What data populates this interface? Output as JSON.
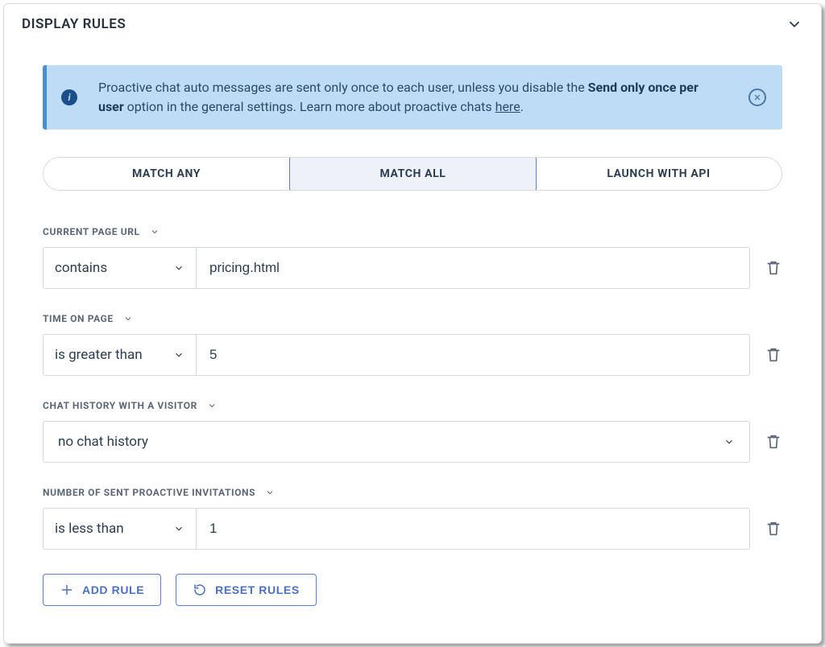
{
  "header": {
    "title": "DISPLAY RULES"
  },
  "banner": {
    "text_a": "Proactive chat auto messages are sent only once to each user, unless you disable the ",
    "bold": "Send only once per user",
    "text_b": " option in the general settings. Learn more about proactive chats ",
    "link": "here",
    "text_c": "."
  },
  "tabs": {
    "items": [
      {
        "label": "MATCH ANY"
      },
      {
        "label": "MATCH ALL"
      },
      {
        "label": "LAUNCH WITH API"
      }
    ],
    "active_index": 1
  },
  "rules": [
    {
      "label": "CURRENT PAGE URL",
      "condition": "contains",
      "value": "pricing.html",
      "type": "cond_value"
    },
    {
      "label": "TIME ON PAGE",
      "condition": "is greater than",
      "value": "5",
      "type": "cond_value"
    },
    {
      "label": "CHAT HISTORY WITH A VISITOR",
      "value": "no chat history",
      "type": "single_select"
    },
    {
      "label": "NUMBER OF SENT PROACTIVE INVITATIONS",
      "condition": "is less than",
      "value": "1",
      "type": "cond_value"
    }
  ],
  "buttons": {
    "add": "ADD RULE",
    "reset": "RESET RULES"
  }
}
